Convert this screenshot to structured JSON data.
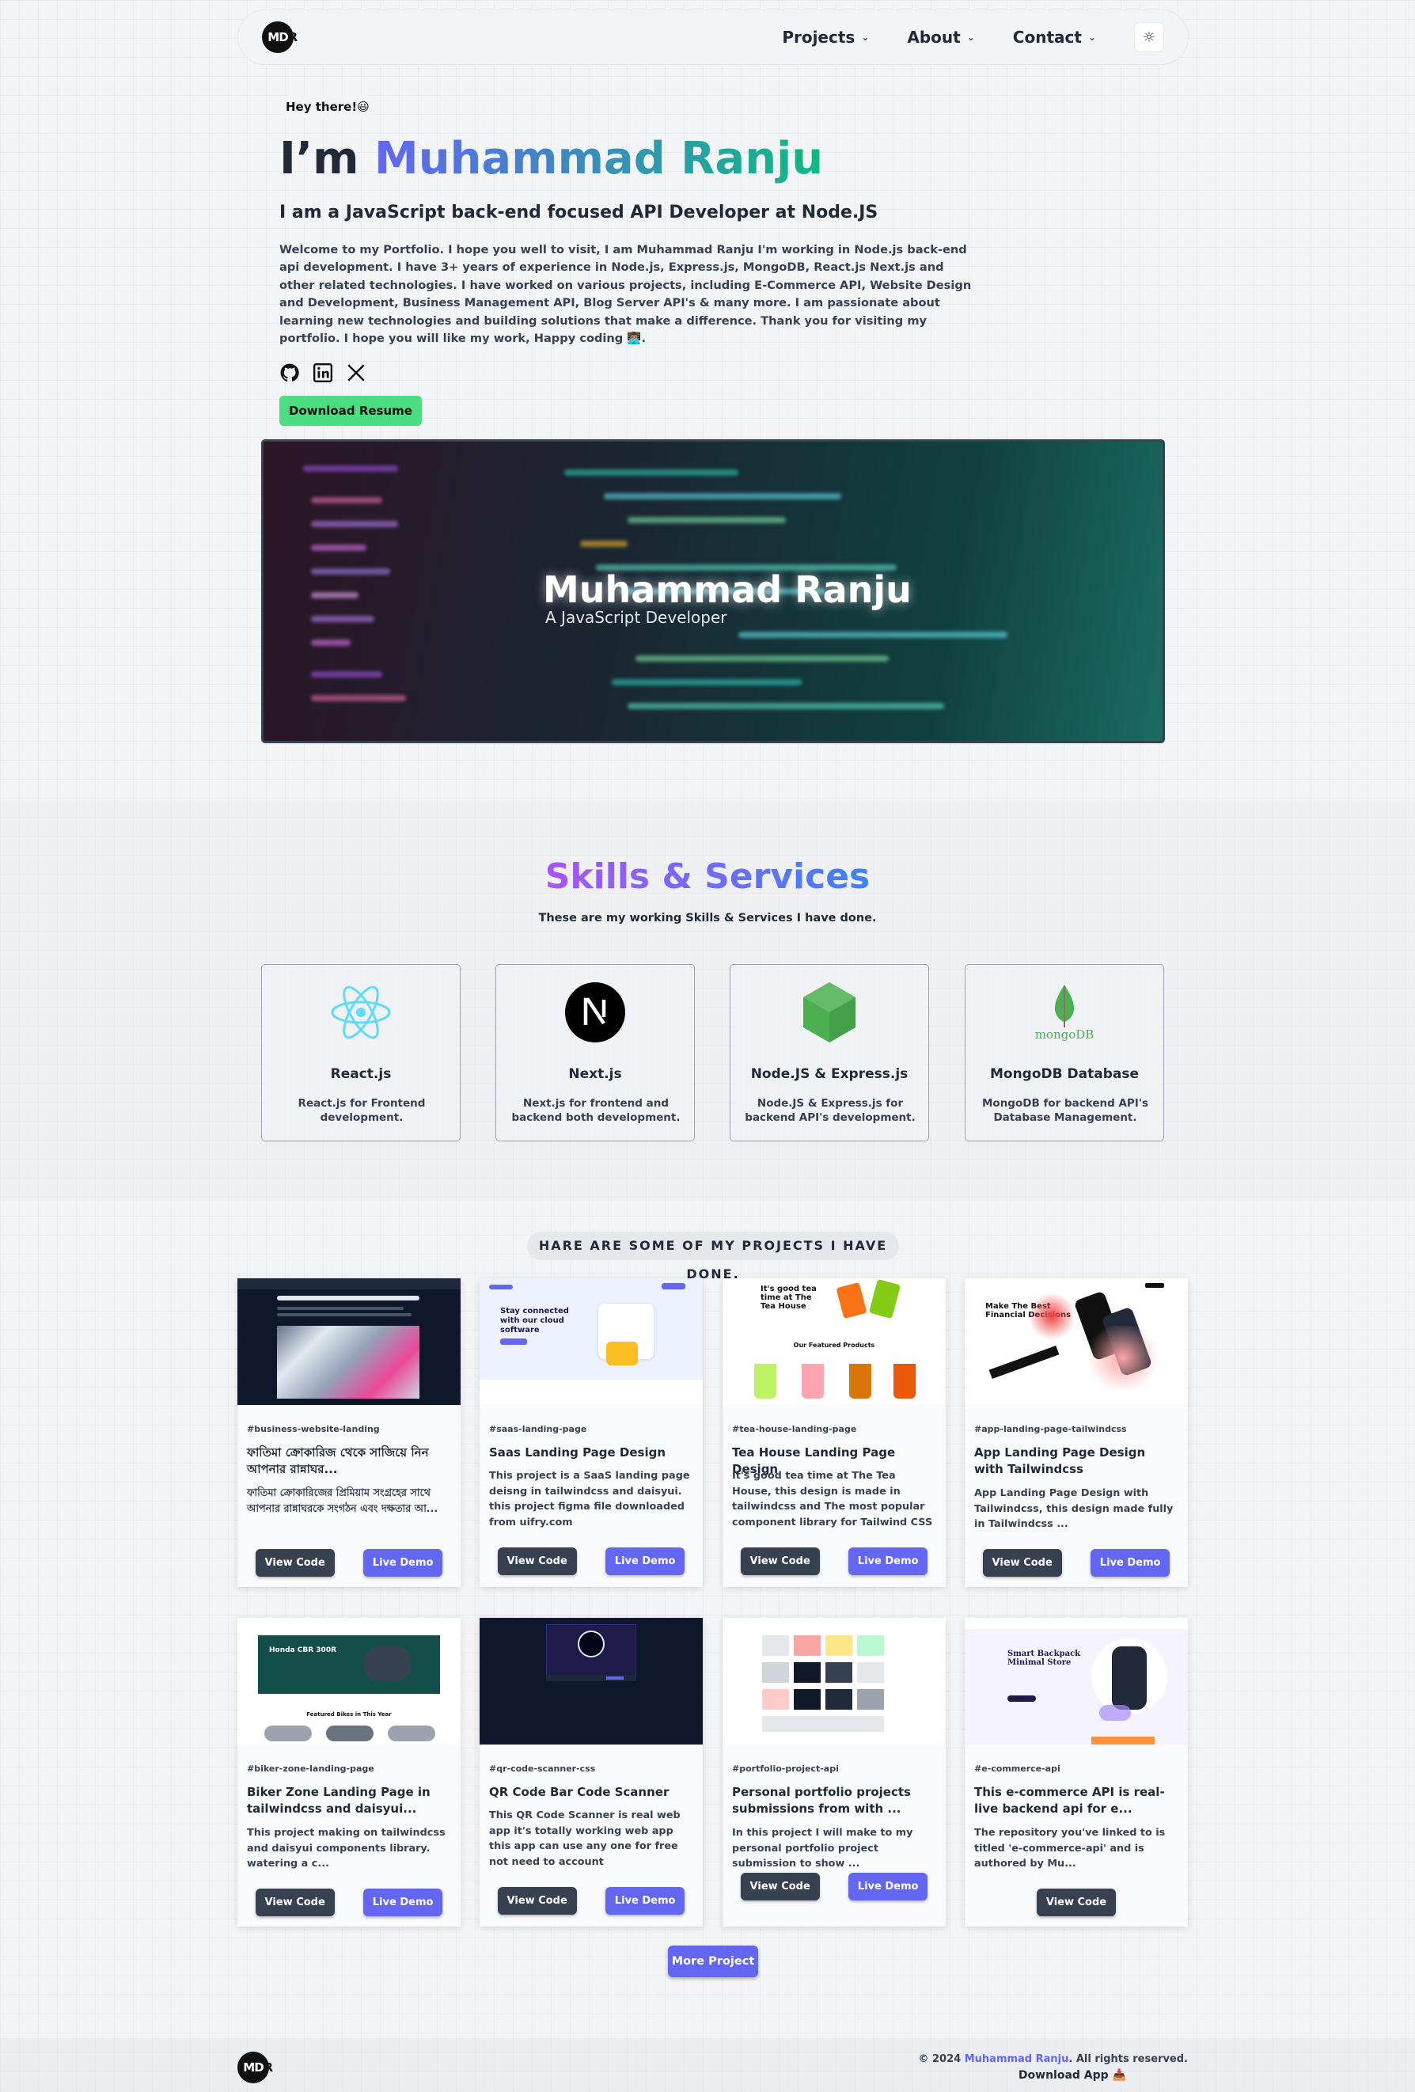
{
  "nav": {
    "logo_text": "MD",
    "logo_r": "R",
    "items": [
      {
        "label": "Projects"
      },
      {
        "label": "About"
      },
      {
        "label": "Contact"
      }
    ],
    "theme_icon": "sun-icon"
  },
  "hero": {
    "greeting": "Hey there!😃",
    "title_prefix": "I’m ",
    "title_name": "Muhammad Ranju",
    "subtitle": "I am a JavaScript back-end focused API Developer at Node.JS",
    "description": "Welcome to my Portfolio. I hope you well to visit, I am Muhammad Ranju I'm working in Node.js back-end api development. I have 3+ years of experience in Node.js, Express.js, MongoDB, React.js Next.js and other related technologies. I have worked on various projects, including E-Commerce API, Website Design and Development, Business Management API, Blog Server API's & many more. I am passionate about learning new technologies and building solutions that make a difference. Thank you for visiting my portfolio. I hope you will like my work, Happy coding 👨🏽‍💻.",
    "socials": [
      "github-icon",
      "linkedin-icon",
      "x-icon"
    ],
    "download_button": "Download Resume"
  },
  "banner": {
    "name": "Muhammad Ranju",
    "role": "A JavaScript Developer"
  },
  "skills": {
    "title": "Skills & Services",
    "subtitle": "These are my working Skills & Services I have done.",
    "cards": [
      {
        "icon": "react-icon",
        "name": "React.js",
        "desc": "React.js for Frontend development."
      },
      {
        "icon": "nextjs-icon",
        "name": "Next.js",
        "desc": "Next.js for frontend and backend both development."
      },
      {
        "icon": "nodejs-icon",
        "name": "Node.JS & Express.js",
        "desc": "Node.JS & Express.js for backend API's development."
      },
      {
        "icon": "mongodb-icon",
        "name": "MongoDB Database",
        "desc": "MongoDB for backend API's Database Management.",
        "logo_text": "mongoDB"
      }
    ]
  },
  "projects": {
    "heading": "HARE ARE SOME OF MY PROJECTS I HAVE DONE.",
    "view_code": "View Code",
    "live_demo": "Live Demo",
    "items": [
      {
        "tag": "#business-website-landing",
        "title": "ফাতিমা ক্রোকারিজ থেকে সাজিয়ে নিন আপনার রান্নাঘর...",
        "desc": "ফাতিমা ক্রোকারিজের প্রিমিয়াম সংগ্রহের সাথে আপনার রান্নাঘরকে সংগঠন এবং দক্ষতার আ..."
      },
      {
        "tag": "#saas-landing-page",
        "title": "Saas Landing Page Design",
        "desc": "This project is a SaaS landing page deisng in tailwindcss and daisyui. this project figma file downloaded from uifry.com"
      },
      {
        "tag": "#tea-house-landing-page",
        "title": "Tea House Landing Page Design",
        "desc": "It's good tea time at The Tea House, this design is made in tailwindcss and The most popular component library for Tailwind CSS"
      },
      {
        "tag": "#app-landing-page-tailwindcss",
        "title": "App Landing Page Design with Tailwindcss",
        "desc": "App Landing Page Design with Tailwindcss, this design made fully in Tailwindcss ..."
      },
      {
        "tag": "#biker-zone-landing-page",
        "title": "Biker Zone Landing Page in tailwindcss and daisyui...",
        "desc": "This project making on tailwindcss and daisyui components library. watering a c..."
      },
      {
        "tag": "#qr-code-scanner-css",
        "title": "QR Code Bar Code Scanner",
        "desc": "This QR Code Scanner is real web app it's totally working web app this app can use any one for free not need to account"
      },
      {
        "tag": "#portfolio-project-api",
        "title": "Personal portfolio projects submissions from with ...",
        "desc": "In this project I will make to my personal portfolio project submission to show ..."
      },
      {
        "tag": "#e-commerce-api",
        "title": "This e-commerce API is real-live backend api for e...",
        "desc": "The repository you've linked to is titled 'e-commerce-api' and is authored by Mu..."
      }
    ],
    "thumb_texts": {
      "tea": "It's good tea time at The Tea House",
      "tea_products": "Our Featured Products",
      "app": "Make The Best Financial Decisions",
      "saas": "Stay connected with our cloud software",
      "biker": "Honda CBR 300R",
      "biker_featured": "Featured Bikes in This Year",
      "backpack": "Smart Backpack Minimal Store"
    },
    "more_button": "More Project"
  },
  "footer": {
    "copyright_prefix": "© 2024 ",
    "copyright_name": "Muhammad Ranju",
    "copyright_suffix": ". All rights reserved.",
    "download_app": "Download App 📥"
  },
  "colors": {
    "accent": "#6366f1",
    "download_green": "#4ade80",
    "dark_button": "#374151"
  }
}
